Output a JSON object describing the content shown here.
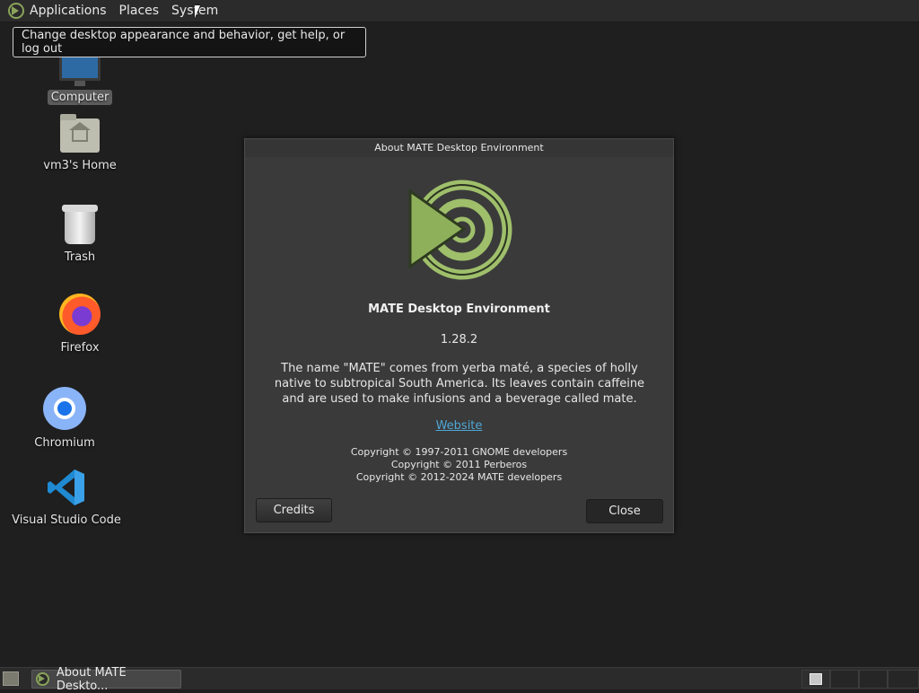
{
  "top_panel": {
    "menus": [
      "Applications",
      "Places",
      "System"
    ]
  },
  "tooltip": {
    "text": "Change desktop appearance and behavior, get help, or log out"
  },
  "desktop_icons": [
    {
      "label": "Computer",
      "icon": "computer-icon"
    },
    {
      "label": "vm3's Home",
      "icon": "home-folder-icon"
    },
    {
      "label": "Trash",
      "icon": "trash-icon"
    },
    {
      "label": "Firefox",
      "icon": "firefox-icon"
    },
    {
      "label": "Chromium",
      "icon": "chromium-icon"
    },
    {
      "label": "Visual Studio Code",
      "icon": "vscode-icon"
    }
  ],
  "dialog": {
    "title": "About MATE Desktop Environment",
    "app_name": "MATE Desktop Environment",
    "version": "1.28.2",
    "description": "The name \"MATE\" comes from yerba maté, a species of holly native to subtropical South America. Its leaves contain caffeine and are used to make infusions and a beverage called mate.",
    "website": "Website",
    "copyright": [
      "Copyright © 1997-2011 GNOME developers",
      "Copyright © 2011 Perberos",
      "Copyright © 2012-2024 MATE developers"
    ],
    "credits_label": "Credits",
    "close_label": "Close"
  },
  "bottom_panel": {
    "task_label": "About MATE Deskto..."
  },
  "colors": {
    "mate_green": "#8aa35a",
    "link": "#4fa6d6",
    "background": "#1f1f1f"
  }
}
